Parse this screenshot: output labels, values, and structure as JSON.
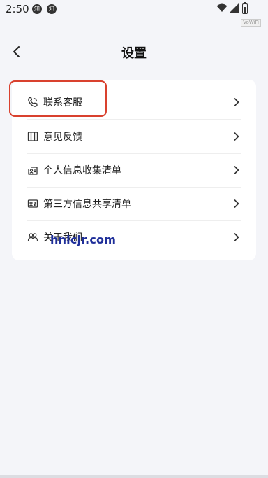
{
  "status_bar": {
    "time": "2:50",
    "notifications": [
      "知",
      "知"
    ],
    "vowifi": "VoWiFi"
  },
  "header": {
    "title": "设置"
  },
  "menu": {
    "items": [
      {
        "label": "联系客服",
        "icon": "phone-icon"
      },
      {
        "label": "意见反馈",
        "icon": "feedback-icon"
      },
      {
        "label": "个人信息收集清单",
        "icon": "personal-info-icon"
      },
      {
        "label": "第三方信息共享清单",
        "icon": "third-party-share-icon"
      },
      {
        "label": "关于我们",
        "icon": "about-us-icon"
      }
    ]
  },
  "colors": {
    "highlight": "#d9412e",
    "watermark": "#1f2f9a",
    "background": "#f4f5f9"
  },
  "watermark": "hnlcjr.com"
}
